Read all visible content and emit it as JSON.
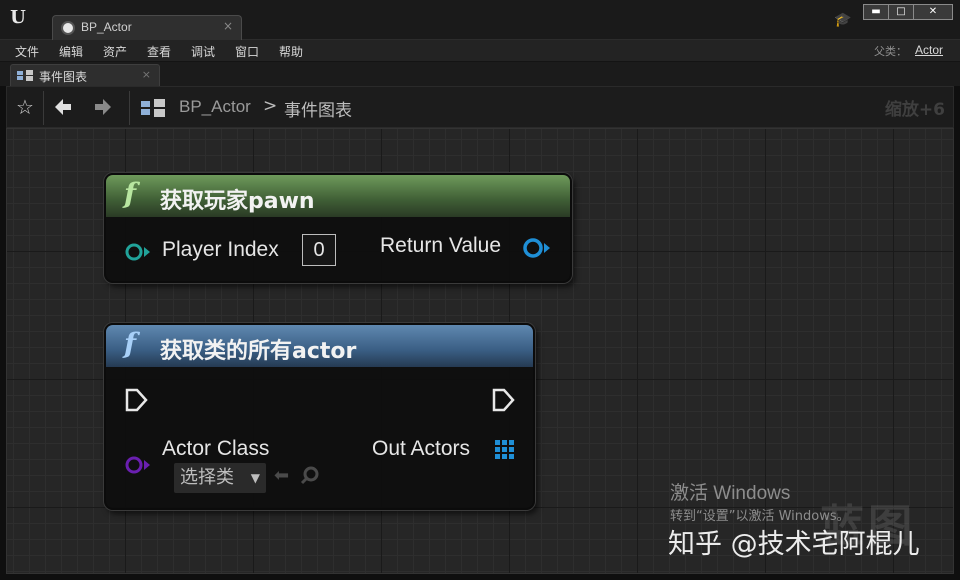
{
  "window": {
    "tab_title": "BP_Actor",
    "tab_close": "×",
    "min_btn": "▬",
    "max_btn": "□",
    "close_btn": "✕"
  },
  "menu": {
    "items": [
      "文件",
      "编辑",
      "资产",
      "查看",
      "调试",
      "窗口",
      "帮助"
    ],
    "parent_label": "父类：",
    "parent_value": "Actor"
  },
  "graph_tab": {
    "label": "事件图表",
    "close": "×"
  },
  "breadcrumb": {
    "blueprint": "BP_Actor",
    "separator": ">",
    "graph": "事件图表",
    "zoom": "缩放+6"
  },
  "nodes": {
    "get_player_pawn": {
      "fx": "f",
      "title": "获取玩家pawn",
      "input_label": "Player Index",
      "input_value": "0",
      "output_label": "Return Value",
      "header_color": "#4f7a43"
    },
    "get_all_actors": {
      "fx": "f",
      "title": "获取类的所有actor",
      "input_label": "Actor Class",
      "dropdown_value": "选择类",
      "output_label": "Out Actors",
      "header_color": "#3d6690"
    }
  },
  "pin_colors": {
    "object": "#21a39a",
    "object_out": "#1f8fd6",
    "class": "#6a1fb0",
    "exec": "#e8e8e8",
    "array": "#1f8fd6"
  },
  "watermark": {
    "activate_title": "激活 Windows",
    "activate_sub": "转到“设置”以激活 Windows。",
    "zhihu": "知乎 @技术宅阿棍儿",
    "corner": "蓝图"
  }
}
